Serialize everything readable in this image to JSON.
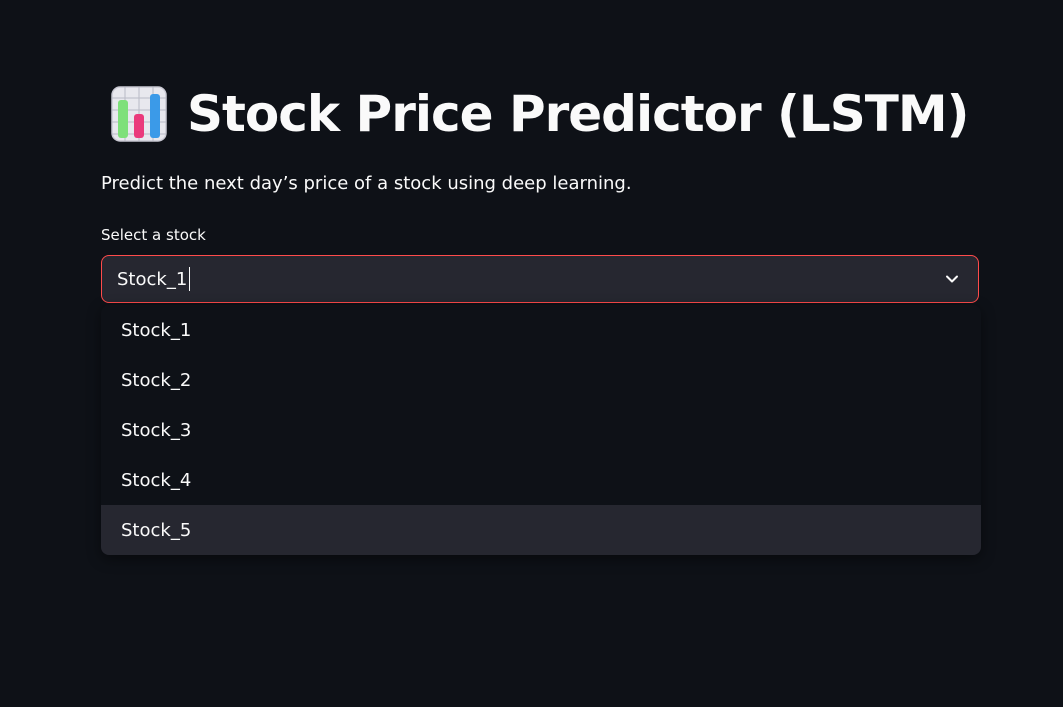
{
  "header": {
    "title": "Stock Price Predictor (LSTM)",
    "subtitle": "Predict the next day’s price of a stock using deep learning.",
    "icon": "bar-chart-icon"
  },
  "select": {
    "label": "Select a stock",
    "value": "Stock_1",
    "border_color": "#ff4b4b",
    "options": [
      "Stock_1",
      "Stock_2",
      "Stock_3",
      "Stock_4",
      "Stock_5"
    ],
    "highlighted_option": "Stock_5"
  },
  "colors": {
    "background": "#0e1117",
    "input_background": "#262730",
    "text": "#fafafa",
    "accent": "#ff4b4b"
  }
}
